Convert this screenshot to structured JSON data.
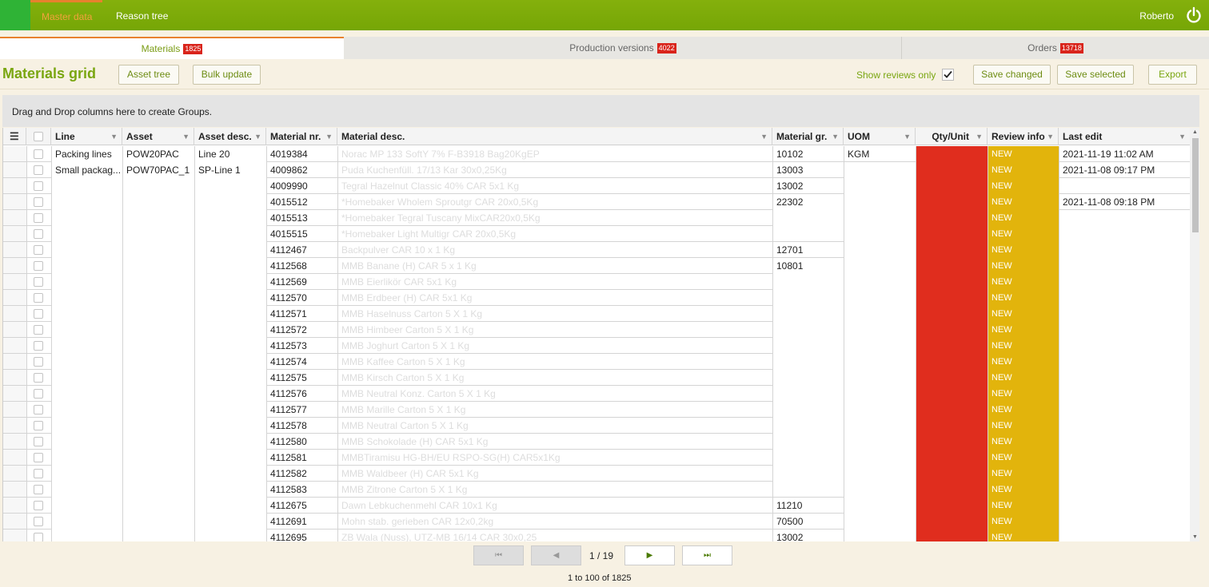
{
  "topbar": {
    "nav_active": "Master data",
    "nav_reason_tree": "Reason tree",
    "user": "Roberto"
  },
  "tabs": [
    {
      "label": "Materials",
      "count": "1825"
    },
    {
      "label": "Production versions",
      "count": "4022"
    },
    {
      "label": "Orders",
      "count": "13718"
    }
  ],
  "toolbar": {
    "title": "Materials grid",
    "asset_tree": "Asset tree",
    "bulk_update": "Bulk update",
    "show_reviews": "Show reviews only",
    "show_reviews_checked": true,
    "save_changed": "Save changed",
    "save_selected": "Save selected",
    "export": "Export"
  },
  "group_hint": "Drag and Drop columns here to create Groups.",
  "columns": {
    "line": "Line",
    "asset": "Asset",
    "asset_desc": "Asset desc.",
    "material_nr": "Material nr.",
    "material_desc": "Material desc.",
    "material_gr": "Material gr.",
    "uom": "UOM",
    "qty_unit": "Qty/Unit",
    "review_info": "Review info",
    "last_edit": "Last edit"
  },
  "rows": [
    {
      "line": "Packing lines",
      "asset": "POW20PAC",
      "asset_desc": "Line 20",
      "material_nr": "4019384",
      "material_desc": "Norac MP 133 SoftY 7% F-B3918 Bag20KgEP",
      "material_gr": "10102",
      "uom": "KGM",
      "review": "NEW",
      "last_edit": "2021-11-19 11:02 AM"
    },
    {
      "line": "Small packag...",
      "asset": "POW70PAC_1",
      "asset_desc": "SP-Line 1",
      "material_nr": "4009862",
      "material_desc": "Puda Kuchenfüll. 17/13 Kar 30x0,25Kg",
      "material_gr": "13003",
      "uom": "",
      "review": "NEW",
      "last_edit": "2021-11-08 09:17 PM"
    },
    {
      "line": "",
      "asset": "",
      "asset_desc": "",
      "material_nr": "4009990",
      "material_desc": "Tegral Hazelnut Classic 40% CAR 5x1 Kg",
      "material_gr": "13002",
      "uom": "",
      "review": "NEW",
      "last_edit": ""
    },
    {
      "line": "",
      "asset": "",
      "asset_desc": "",
      "material_nr": "4015512",
      "material_desc": "*Homebaker Wholem Sproutgr CAR 20x0,5Kg",
      "material_gr": "22302",
      "uom": "",
      "review": "NEW",
      "last_edit": "2021-11-08 09:18 PM"
    },
    {
      "line": "",
      "asset": "",
      "asset_desc": "",
      "material_nr": "4015513",
      "material_desc": "*Homebaker Tegral Tuscany MixCAR20x0,5Kg",
      "material_gr": "",
      "uom": "",
      "review": "NEW",
      "last_edit": ""
    },
    {
      "line": "",
      "asset": "",
      "asset_desc": "",
      "material_nr": "4015515",
      "material_desc": "*Homebaker Light Multigr CAR 20x0,5Kg",
      "material_gr": "",
      "uom": "",
      "review": "NEW",
      "last_edit": ""
    },
    {
      "line": "",
      "asset": "",
      "asset_desc": "",
      "material_nr": "4112467",
      "material_desc": "Backpulver CAR 10 x 1 Kg",
      "material_gr": "12701",
      "uom": "",
      "review": "NEW",
      "last_edit": ""
    },
    {
      "line": "",
      "asset": "",
      "asset_desc": "",
      "material_nr": "4112568",
      "material_desc": "MMB Banane (H) CAR 5 x 1 Kg",
      "material_gr": "10801",
      "uom": "",
      "review": "NEW",
      "last_edit": ""
    },
    {
      "line": "",
      "asset": "",
      "asset_desc": "",
      "material_nr": "4112569",
      "material_desc": "MMB Eierlikör CAR 5x1 Kg",
      "material_gr": "",
      "uom": "",
      "review": "NEW",
      "last_edit": ""
    },
    {
      "line": "",
      "asset": "",
      "asset_desc": "",
      "material_nr": "4112570",
      "material_desc": "MMB Erdbeer (H) CAR 5x1 Kg",
      "material_gr": "",
      "uom": "",
      "review": "NEW",
      "last_edit": ""
    },
    {
      "line": "",
      "asset": "",
      "asset_desc": "",
      "material_nr": "4112571",
      "material_desc": "MMB Haselnuss Carton 5 X 1 Kg",
      "material_gr": "",
      "uom": "",
      "review": "NEW",
      "last_edit": ""
    },
    {
      "line": "",
      "asset": "",
      "asset_desc": "",
      "material_nr": "4112572",
      "material_desc": "MMB Himbeer Carton 5 X 1 Kg",
      "material_gr": "",
      "uom": "",
      "review": "NEW",
      "last_edit": ""
    },
    {
      "line": "",
      "asset": "",
      "asset_desc": "",
      "material_nr": "4112573",
      "material_desc": "MMB Joghurt Carton 5 X 1 Kg",
      "material_gr": "",
      "uom": "",
      "review": "NEW",
      "last_edit": ""
    },
    {
      "line": "",
      "asset": "",
      "asset_desc": "",
      "material_nr": "4112574",
      "material_desc": "MMB Kaffee Carton 5 X 1 Kg",
      "material_gr": "",
      "uom": "",
      "review": "NEW",
      "last_edit": ""
    },
    {
      "line": "",
      "asset": "",
      "asset_desc": "",
      "material_nr": "4112575",
      "material_desc": "MMB Kirsch Carton 5 X 1 Kg",
      "material_gr": "",
      "uom": "",
      "review": "NEW",
      "last_edit": ""
    },
    {
      "line": "",
      "asset": "",
      "asset_desc": "",
      "material_nr": "4112576",
      "material_desc": "MMB Neutral Konz. Carton 5 X 1 Kg",
      "material_gr": "",
      "uom": "",
      "review": "NEW",
      "last_edit": ""
    },
    {
      "line": "",
      "asset": "",
      "asset_desc": "",
      "material_nr": "4112577",
      "material_desc": "MMB Marille Carton 5 X 1 Kg",
      "material_gr": "",
      "uom": "",
      "review": "NEW",
      "last_edit": ""
    },
    {
      "line": "",
      "asset": "",
      "asset_desc": "",
      "material_nr": "4112578",
      "material_desc": "MMB Neutral Carton 5 X 1 Kg",
      "material_gr": "",
      "uom": "",
      "review": "NEW",
      "last_edit": ""
    },
    {
      "line": "",
      "asset": "",
      "asset_desc": "",
      "material_nr": "4112580",
      "material_desc": "MMB Schokolade (H) CAR 5x1 Kg",
      "material_gr": "",
      "uom": "",
      "review": "NEW",
      "last_edit": ""
    },
    {
      "line": "",
      "asset": "",
      "asset_desc": "",
      "material_nr": "4112581",
      "material_desc": "MMBTiramisu HG-BH/EU RSPO-SG(H) CAR5x1Kg",
      "material_gr": "",
      "uom": "",
      "review": "NEW",
      "last_edit": ""
    },
    {
      "line": "",
      "asset": "",
      "asset_desc": "",
      "material_nr": "4112582",
      "material_desc": "MMB Waldbeer (H) CAR 5x1 Kg",
      "material_gr": "",
      "uom": "",
      "review": "NEW",
      "last_edit": ""
    },
    {
      "line": "",
      "asset": "",
      "asset_desc": "",
      "material_nr": "4112583",
      "material_desc": "MMB Zitrone Carton 5 X 1 Kg",
      "material_gr": "",
      "uom": "",
      "review": "NEW",
      "last_edit": ""
    },
    {
      "line": "",
      "asset": "",
      "asset_desc": "",
      "material_nr": "4112675",
      "material_desc": "Dawn Lebkuchenmehl CAR 10x1 Kg",
      "material_gr": "11210",
      "uom": "",
      "review": "NEW",
      "last_edit": ""
    },
    {
      "line": "",
      "asset": "",
      "asset_desc": "",
      "material_nr": "4112691",
      "material_desc": "Mohn stab. gerieben CAR 12x0,2kg",
      "material_gr": "70500",
      "uom": "",
      "review": "NEW",
      "last_edit": ""
    },
    {
      "line": "",
      "asset": "",
      "asset_desc": "",
      "material_nr": "4112695",
      "material_desc": "ZB Wala (Nuss), UTZ-MB 16/14 CAR 30x0,25",
      "material_gr": "13002",
      "uom": "",
      "review": "NEW",
      "last_edit": ""
    }
  ],
  "pager": {
    "first": "⏮",
    "prev": "◀",
    "page": "1 / 19",
    "next": "▶",
    "last": "⏭",
    "summary": "1 to 100 of 1825"
  },
  "colors": {
    "topbar": "#7aaa08",
    "accent": "#7aa611",
    "qty_red": "#e02d1e",
    "review_yellow": "#e2b40c",
    "badge_red": "#d9241b"
  }
}
